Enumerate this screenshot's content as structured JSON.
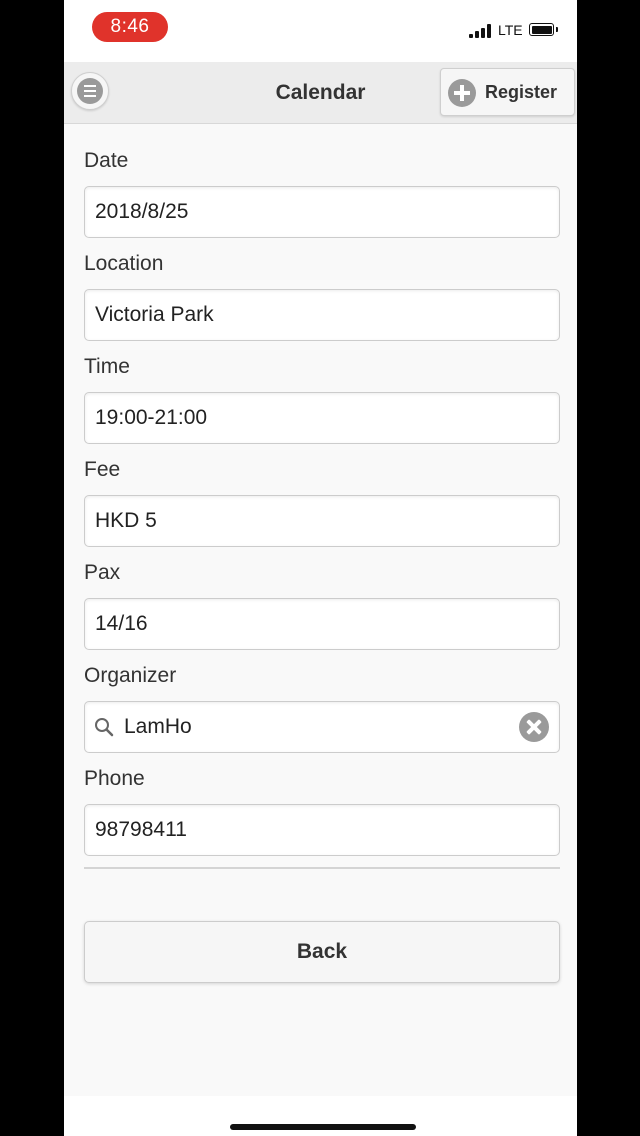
{
  "status_bar": {
    "time": "8:46",
    "network": "LTE"
  },
  "nav": {
    "title": "Calendar",
    "register_label": "Register"
  },
  "fields": [
    {
      "label": "Date",
      "value": "2018/8/25"
    },
    {
      "label": "Location",
      "value": "Victoria Park"
    },
    {
      "label": "Time",
      "value": "19:00-21:00"
    },
    {
      "label": "Fee",
      "value": "HKD 5"
    },
    {
      "label": "Pax",
      "value": "14/16"
    },
    {
      "label": "Organizer",
      "value": "LamHo"
    },
    {
      "label": "Phone",
      "value": "98798411"
    }
  ],
  "back_label": "Back",
  "colors": {
    "time_pill": "#e0332b",
    "icon_gray": "#9a9a9a",
    "nav_bg": "#ececec"
  },
  "icons": [
    "menu-icon",
    "plus-icon",
    "search-icon",
    "clear-icon"
  ]
}
